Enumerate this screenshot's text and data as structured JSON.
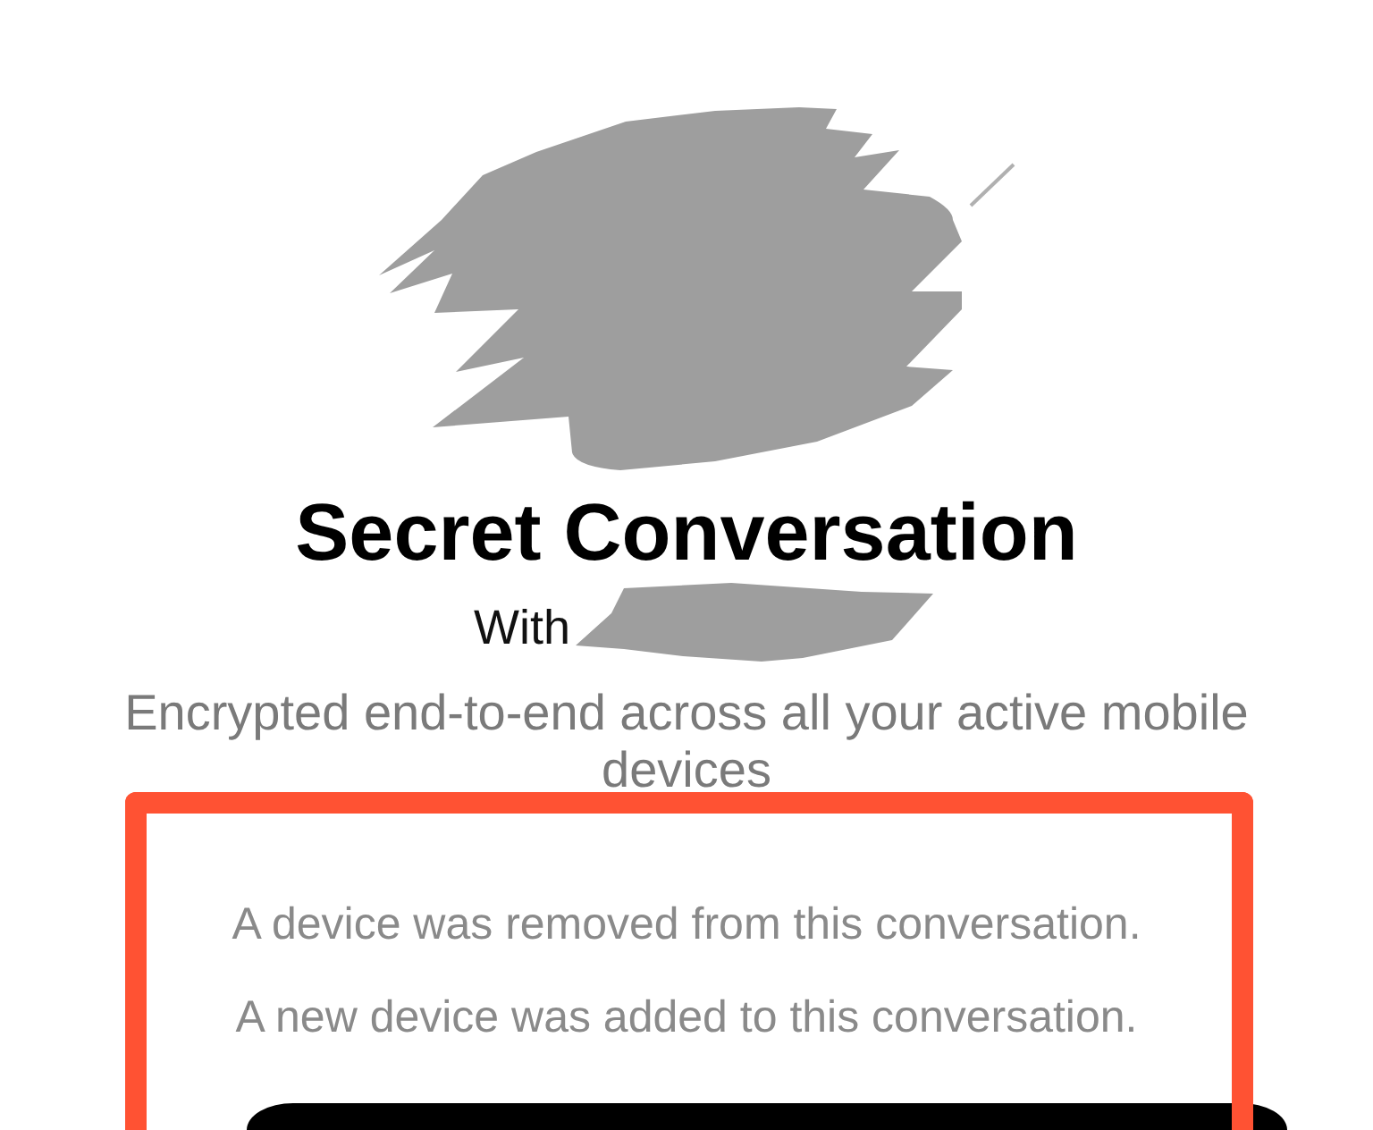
{
  "header": {
    "title": "Secret Conversation",
    "with_label": "With",
    "subtitle": "Encrypted end-to-end across all your active mobile devices"
  },
  "notices": [
    "A device was removed from this conversation.",
    "A new device was added to this conversation."
  ]
}
